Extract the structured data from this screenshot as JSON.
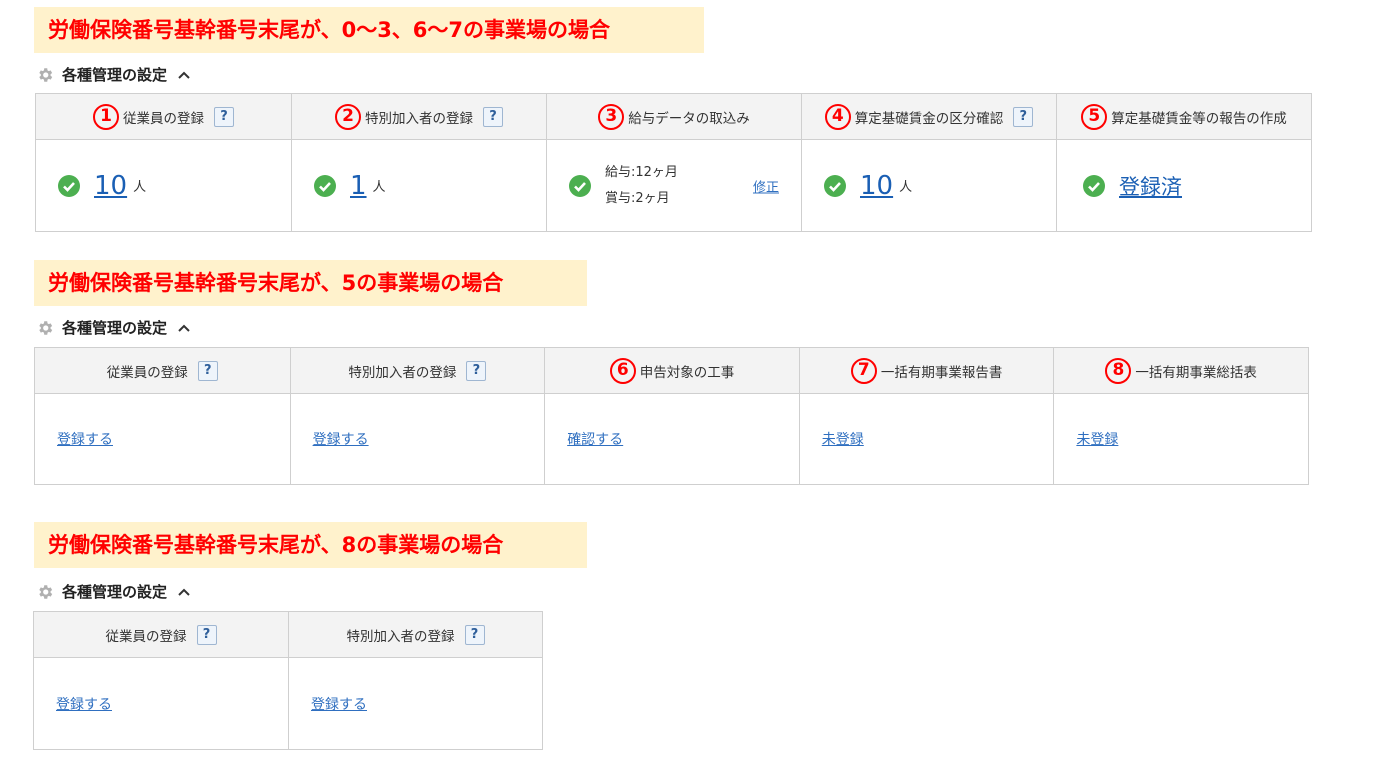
{
  "sections": [
    {
      "banner": "労働保険番号基幹番号末尾が、0～3、6～7の事業場の場合",
      "heading": "各種管理の設定",
      "columns": [
        {
          "num": "1",
          "title": "従業員の登録",
          "help": "?",
          "count": "10",
          "unit": "人"
        },
        {
          "num": "2",
          "title": "特別加入者の登録",
          "help": "?",
          "count": "1",
          "unit": "人"
        },
        {
          "num": "3",
          "title": "給与データの取込み",
          "line1": "給与:12ヶ月",
          "line2": "賞与:2ヶ月",
          "fix": "修正"
        },
        {
          "num": "4",
          "title": "算定基礎賃金の区分確認",
          "help": "?",
          "count": "10",
          "unit": "人"
        },
        {
          "num": "5",
          "title": "算定基礎賃金等の報告の作成",
          "status": "登録済"
        }
      ]
    },
    {
      "banner": "労働保険番号基幹番号末尾が、5の事業場の場合",
      "heading": "各種管理の設定",
      "columns": [
        {
          "title": "従業員の登録",
          "help": "?",
          "link": "登録する"
        },
        {
          "title": "特別加入者の登録",
          "help": "?",
          "link": "登録する"
        },
        {
          "num": "6",
          "title": "申告対象の工事",
          "link": "確認する"
        },
        {
          "num": "7",
          "title": "一括有期事業報告書",
          "link": "未登録"
        },
        {
          "num": "8",
          "title": "一括有期事業総括表",
          "link": "未登録"
        }
      ]
    },
    {
      "banner": "労働保険番号基幹番号末尾が、8の事業場の場合",
      "heading": "各種管理の設定",
      "columns": [
        {
          "title": "従業員の登録",
          "help": "?",
          "link": "登録する"
        },
        {
          "title": "特別加入者の登録",
          "help": "?",
          "link": "登録する"
        }
      ]
    }
  ],
  "colors": {
    "accent_red": "#ff0000",
    "banner_bg": "#fff2cc",
    "link_blue": "#1a5fb4",
    "check_green": "#4caf50"
  }
}
